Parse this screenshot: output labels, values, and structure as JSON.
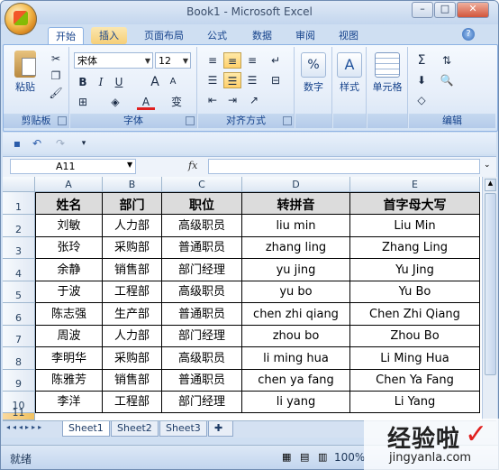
{
  "window": {
    "title": "Book1 - Microsoft Excel",
    "min": "–",
    "max": "□",
    "close": "✕"
  },
  "ribbon_tabs": [
    "开始",
    "插入",
    "页面布局",
    "公式",
    "数据",
    "审阅",
    "视图"
  ],
  "ribbon": {
    "clipboard": {
      "paste": "粘贴",
      "label": "剪贴板"
    },
    "font": {
      "name": "宋体",
      "size": "12",
      "bold": "B",
      "italic": "I",
      "underline": "U",
      "grow": "A",
      "shrink": "A",
      "color": "A",
      "wen": "wén",
      "zi": "变",
      "label": "字体"
    },
    "alignment": {
      "label": "对齐方式"
    },
    "number": {
      "label": "数字",
      "icon": "%"
    },
    "styles": {
      "label": "样式"
    },
    "cells": {
      "label": "单元格"
    },
    "editing": {
      "label": "编辑",
      "sum": "Σ"
    }
  },
  "formula_bar": {
    "cell_ref": "A11",
    "fx": "fx",
    "value": ""
  },
  "columns": [
    "A",
    "B",
    "C",
    "D",
    "E"
  ],
  "rows": [
    "1",
    "2",
    "3",
    "4",
    "5",
    "6",
    "7",
    "8",
    "9",
    "10",
    "11"
  ],
  "table": {
    "headers": [
      "姓名",
      "部门",
      "职位",
      "转拼音",
      "首字母大写"
    ],
    "data": [
      [
        "刘敏",
        "人力部",
        "高级职员",
        "liu min",
        "Liu Min"
      ],
      [
        "张玲",
        "采购部",
        "普通职员",
        "zhang ling",
        "Zhang Ling"
      ],
      [
        "余静",
        "销售部",
        "部门经理",
        "yu jing",
        "Yu Jing"
      ],
      [
        "于波",
        "工程部",
        "高级职员",
        "yu bo",
        "Yu Bo"
      ],
      [
        "陈志强",
        "生产部",
        "普通职员",
        "chen zhi qiang",
        "Chen Zhi Qiang"
      ],
      [
        "周波",
        "人力部",
        "部门经理",
        "zhou bo",
        "Zhou Bo"
      ],
      [
        "李明华",
        "采购部",
        "高级职员",
        "li ming hua",
        "Li Ming Hua"
      ],
      [
        "陈雅芳",
        "销售部",
        "普通职员",
        "chen ya fang",
        "Chen Ya Fang"
      ],
      [
        "李洋",
        "工程部",
        "部门经理",
        "li yang",
        "Li Yang"
      ]
    ]
  },
  "sheet_tabs": [
    "Sheet1",
    "Sheet2",
    "Sheet3"
  ],
  "status": {
    "ready": "就绪",
    "zoom": "100%"
  },
  "watermark": {
    "text": "经验啦",
    "url": "jingyanla.com",
    "check": "✓"
  },
  "colors": {
    "accent": "#15428b",
    "header_fill": "#dcdcdc",
    "selected_header": "#f1c15f"
  }
}
